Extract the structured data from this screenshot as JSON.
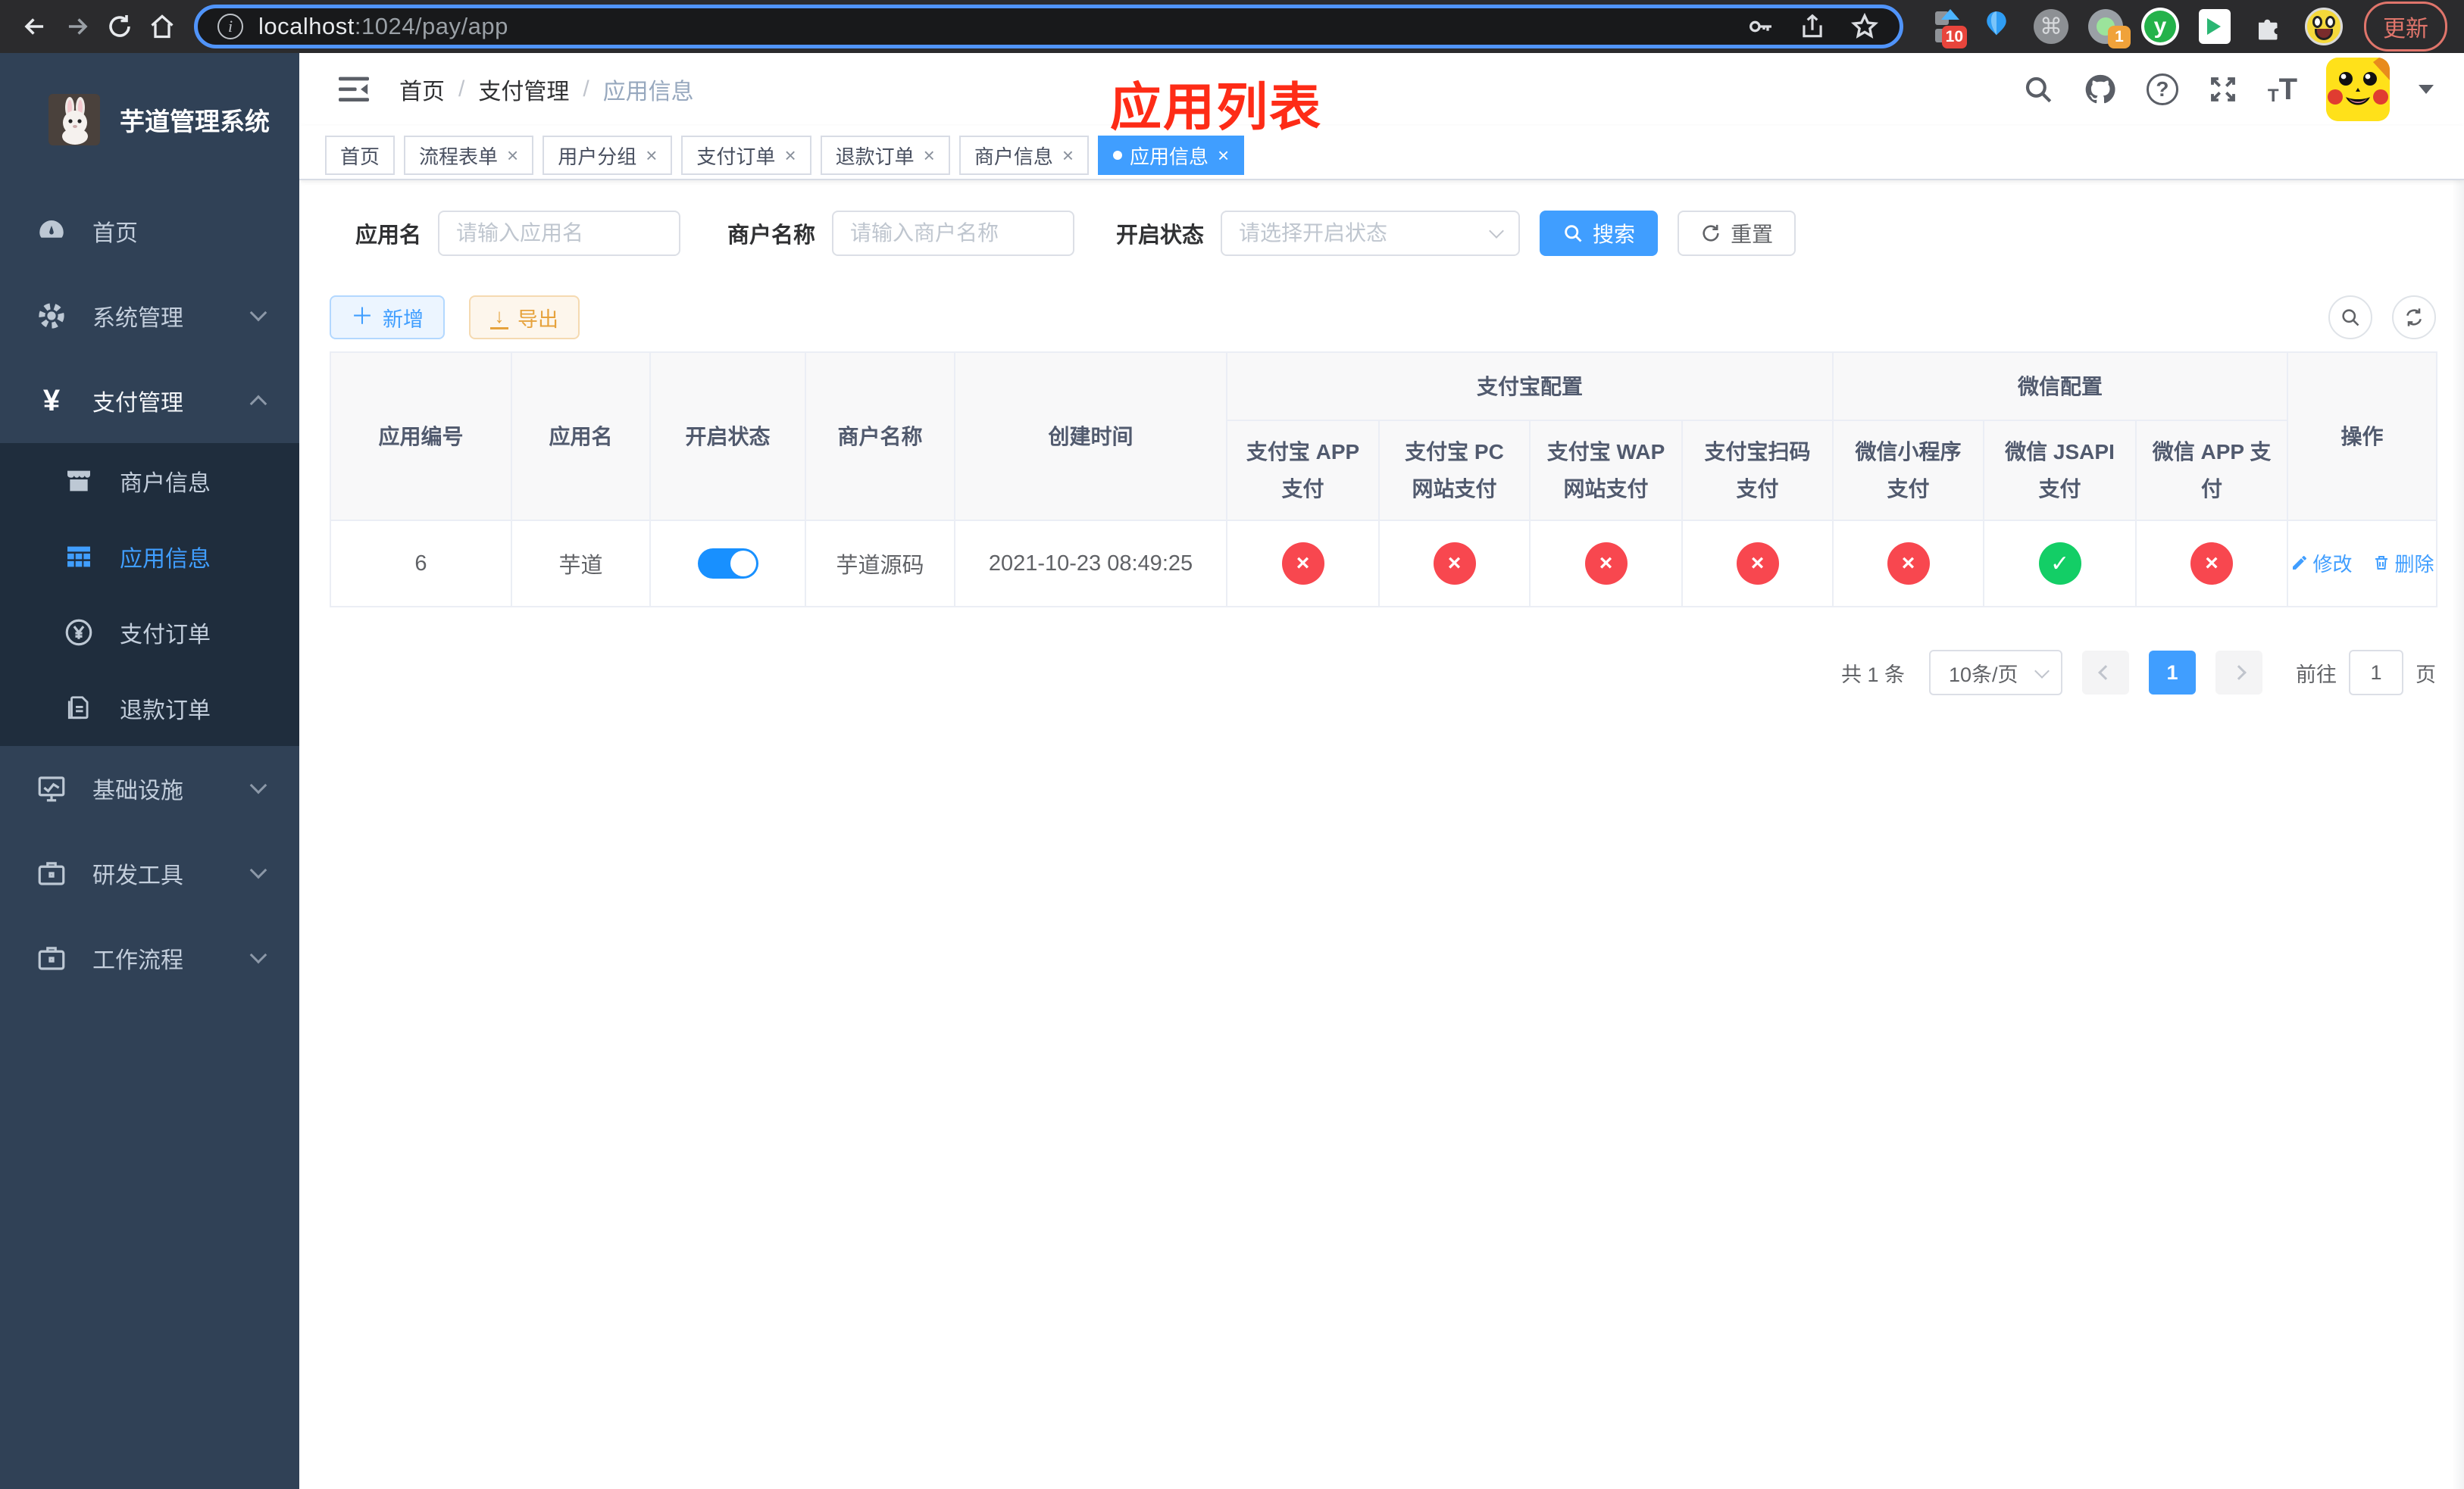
{
  "browser": {
    "url": {
      "host": "localhost",
      "path": ":1024/pay/app"
    },
    "update_label": "更新",
    "badges": {
      "blocks": "10",
      "recorder": "1"
    },
    "y_ext_letter": "y"
  },
  "sidebar": {
    "title": "芋道管理系统",
    "items": [
      {
        "label": "首页"
      },
      {
        "label": "系统管理"
      },
      {
        "label": "支付管理"
      },
      {
        "label": "基础设施"
      },
      {
        "label": "研发工具"
      },
      {
        "label": "工作流程"
      }
    ],
    "submenu": [
      {
        "label": "商户信息"
      },
      {
        "label": "应用信息"
      },
      {
        "label": "支付订单"
      },
      {
        "label": "退款订单"
      }
    ]
  },
  "header": {
    "breadcrumb": [
      "首页",
      "支付管理",
      "应用信息"
    ],
    "annotation": "应用列表"
  },
  "tabs": [
    {
      "label": "首页"
    },
    {
      "label": "流程表单"
    },
    {
      "label": "用户分组"
    },
    {
      "label": "支付订单"
    },
    {
      "label": "退款订单"
    },
    {
      "label": "商户信息"
    },
    {
      "label": "应用信息"
    }
  ],
  "filters": {
    "app_name_label": "应用名",
    "app_name_placeholder": "请输入应用名",
    "merchant_label": "商户名称",
    "merchant_placeholder": "请输入商户名称",
    "status_label": "开启状态",
    "status_placeholder": "请选择开启状态",
    "search_label": "搜索",
    "reset_label": "重置"
  },
  "toolbar": {
    "add_label": "新增",
    "export_label": "导出"
  },
  "table": {
    "groups": [
      "支付宝配置",
      "微信配置"
    ],
    "columns": [
      "应用编号",
      "应用名",
      "开启状态",
      "商户名称",
      "创建时间",
      "支付宝 APP 支付",
      "支付宝 PC 网站支付",
      "支付宝 WAP 网站支付",
      "支付宝扫码支付",
      "微信小程序支付",
      "微信 JSAPI 支付",
      "微信 APP 支付",
      "操作"
    ],
    "glyphs": {
      "success": "✓",
      "fail": "×"
    },
    "row": {
      "id": "6",
      "name": "芋道",
      "enabled": true,
      "merchant": "芋道源码",
      "created_at": "2021-10-23 08:49:25",
      "statuses": [
        "fail",
        "fail",
        "fail",
        "fail",
        "fail",
        "success",
        "fail"
      ],
      "actions": {
        "edit": "修改",
        "delete": "删除"
      }
    }
  },
  "pagination": {
    "total": "共 1 条",
    "page_size": "10条/页",
    "page": "1",
    "goto": "前往",
    "goto_value": "1",
    "unit": "页"
  },
  "colors": {
    "accent": "#409eff",
    "accent-bg": "#ecf5ff",
    "accent-border": "#b3d8ff",
    "warning": "#e6a23c",
    "warning-bg": "#fdf6ec",
    "warning-border": "#f5dab1",
    "success": "#13ce66",
    "danger": "#f8474f",
    "toggle-on": "#1890ff",
    "annotation": "#fe2c17",
    "sidebar-bg": "#304156",
    "submenu-bg": "#1f2d3d",
    "sidebar-text": "#c3cedc",
    "table-header-text": "#515a6e",
    "browser-bar": "#2b2b2d",
    "browser-pill": "#18191b",
    "browser-ring": "#5094fa",
    "browser-text": "#e8eaed",
    "update-red": "#e0756b"
  }
}
